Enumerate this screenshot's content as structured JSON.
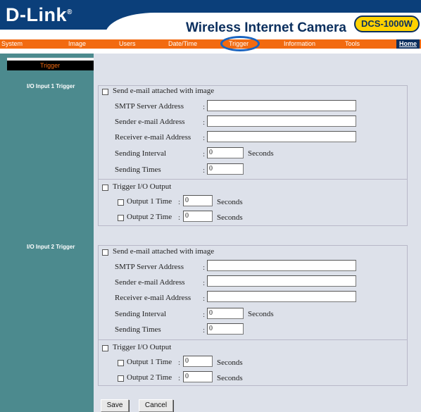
{
  "header": {
    "brand": "D-Link",
    "product_title": "Wireless Internet Camera",
    "model": "DCS-1000W"
  },
  "nav": {
    "items": [
      "System",
      "Image",
      "Users",
      "Date/Time",
      "Trigger",
      "Information",
      "Tools",
      "Home"
    ],
    "active": "Trigger"
  },
  "sidebar": {
    "active_item": "Trigger",
    "section1": "I/O Input 1 Trigger",
    "section2": "I/O Input 2 Trigger"
  },
  "form": {
    "send_email_label": "Send e-mail attached with image",
    "smtp_label": "SMTP Server Address",
    "sender_label": "Sender e-mail Address",
    "receiver_label": "Receiver e-mail Address",
    "interval_label": "Sending Interval",
    "times_label": "Sending Times",
    "seconds_label": "Seconds",
    "trigger_output_label": "Trigger I/O Output",
    "output1_label": "Output 1 Time",
    "output2_label": "Output 2 Time",
    "colon": ":"
  },
  "input1": {
    "send_email_checked": false,
    "smtp_value": "",
    "sender_value": "",
    "receiver_value": "",
    "interval_value": "0",
    "times_value": "0",
    "trigger_output_checked": false,
    "output1_checked": false,
    "output1_value": "0",
    "output2_checked": false,
    "output2_value": "0"
  },
  "input2": {
    "send_email_checked": false,
    "smtp_value": "",
    "sender_value": "",
    "receiver_value": "",
    "interval_value": "0",
    "times_value": "0",
    "trigger_output_checked": false,
    "output1_checked": false,
    "output1_value": "0",
    "output2_checked": false,
    "output2_value": "0"
  },
  "buttons": {
    "save": "Save",
    "cancel": "Cancel"
  },
  "colors": {
    "header_blue": "#0b3f7a",
    "nav_orange": "#f26a10",
    "sidebar_teal": "#4c8a8e",
    "content_bg": "#dde1ea",
    "badge_yellow": "#ffd200",
    "highlight_circle": "#1a64c0"
  }
}
